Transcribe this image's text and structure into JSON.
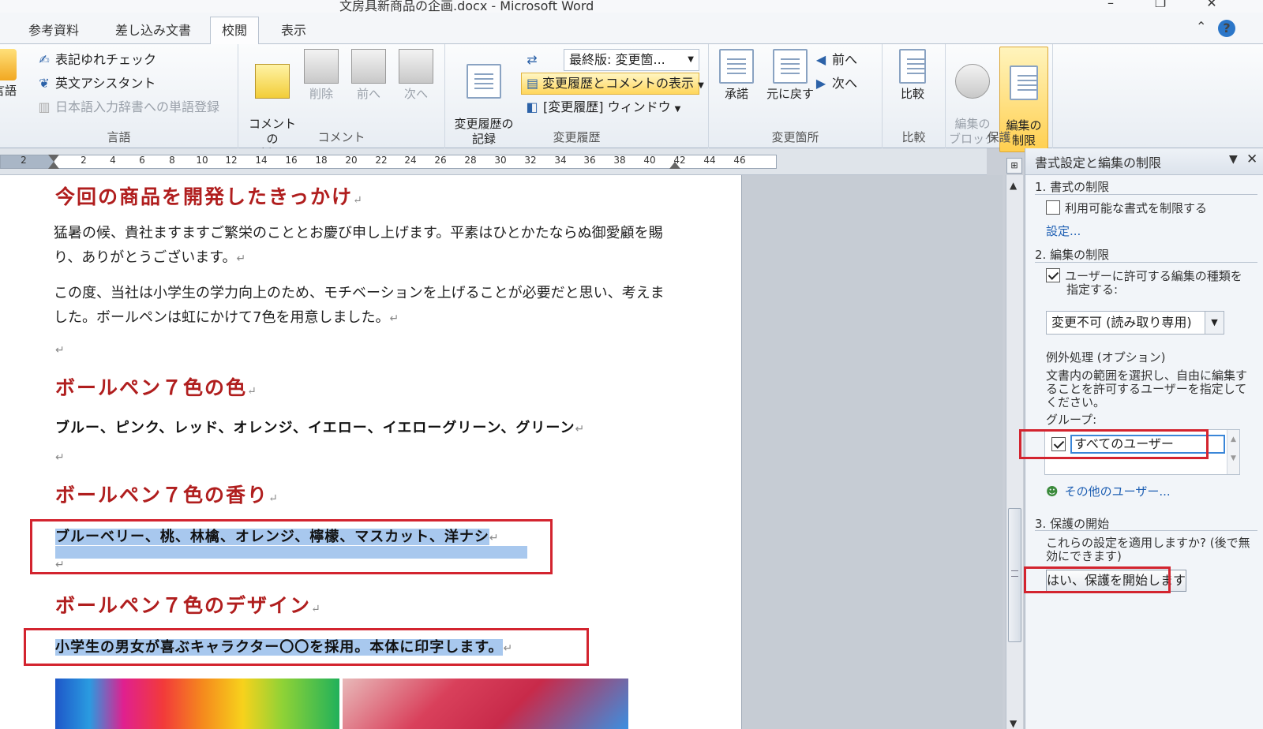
{
  "window": {
    "title": "文房具新商品の企画.docx - Microsoft Word"
  },
  "tabs": [
    {
      "label": "参考資料"
    },
    {
      "label": "差し込み文書"
    },
    {
      "label": "校閲",
      "active": true
    },
    {
      "label": "表示"
    }
  ],
  "ribbon": {
    "lang_group": {
      "label": "言語",
      "btn_spell": "表記ゆれチェック",
      "btn_eng": "英文アシスタント",
      "btn_dict": "日本語入力辞書への単語登録",
      "btn_lang": "言語"
    },
    "comment_group": {
      "label": "コメント",
      "insert": "コメントの\n挿入",
      "delete": "削除",
      "prev": "前へ",
      "next": "次へ"
    },
    "track_group": {
      "label": "変更履歴",
      "record": "変更履歴の\n記録",
      "final_combo": "最終版: 変更箇...",
      "show_markup": "変更履歴とコメントの表示",
      "window": "[変更履歴] ウィンドウ"
    },
    "changes_group": {
      "label": "変更箇所",
      "accept": "承諾",
      "reject": "元に戻す",
      "prev": "前へ",
      "next": "次へ"
    },
    "compare_group": {
      "label": "比較",
      "compare": "比較"
    },
    "protect_group": {
      "label": "保護",
      "block": "編集の\nブロック",
      "restrict": "編集の\n制限"
    }
  },
  "ruler": {
    "ticks": [
      "2",
      "2",
      "4",
      "6",
      "8",
      "10",
      "12",
      "14",
      "16",
      "18",
      "20",
      "22",
      "24",
      "26",
      "28",
      "30",
      "32",
      "34",
      "36",
      "38",
      "40",
      "42",
      "44",
      "46"
    ]
  },
  "document": {
    "h1": "今回の商品を開発したきっかけ",
    "p1": "猛暑の候、貴社ますますご繁栄のこととお慶び申し上げます。平素はひとかたならぬ御愛顧を賜り、ありがとうございます。",
    "p2": "この度、当社は小学生の学力向上のため、モチベーションを上げることが必要だと思い、考えました。ボールペンは虹にかけて7色を用意しました。",
    "h2": "ボールペン７色の色",
    "colors": "ブルー、ピンク、レッド、オレンジ、イエロー、イエローグリーン、グリーン",
    "h3": "ボールペン７色の香り",
    "scents": "ブルーベリー、桃、林檎、オレンジ、檸檬、マスカット、洋ナシ",
    "h4": "ボールペン７色のデザイン",
    "design": "小学生の男女が喜ぶキャラクター〇〇を採用。本体に印字します。",
    "pmark": "↵"
  },
  "pane": {
    "title": "書式設定と編集の制限",
    "sec1": "1. 書式の制限",
    "sec1_check": "利用可能な書式を制限する",
    "sec1_link": "設定...",
    "sec2": "2. 編集の制限",
    "sec2_check": "ユーザーに許可する編集の種類を指定する:",
    "sec2_select": "変更不可 (読み取り専用)",
    "exc_title": "例外処理 (オプション)",
    "exc_desc": "文書内の範囲を選択し、自由に編集することを許可するユーザーを指定してください。",
    "group_label": "グループ:",
    "group_all": "すべてのユーザー",
    "other_users": "その他のユーザー...",
    "sec3": "3. 保護の開始",
    "sec3_desc": "これらの設定を適用しますか? (後で無効にできます)",
    "start_btn": "はい、保護を開始します"
  },
  "colors": {
    "heading": "#b01e1e",
    "highlight_box": "#d3242f",
    "selection": "#a8c8ee",
    "active_button": "#ffcf4f"
  }
}
